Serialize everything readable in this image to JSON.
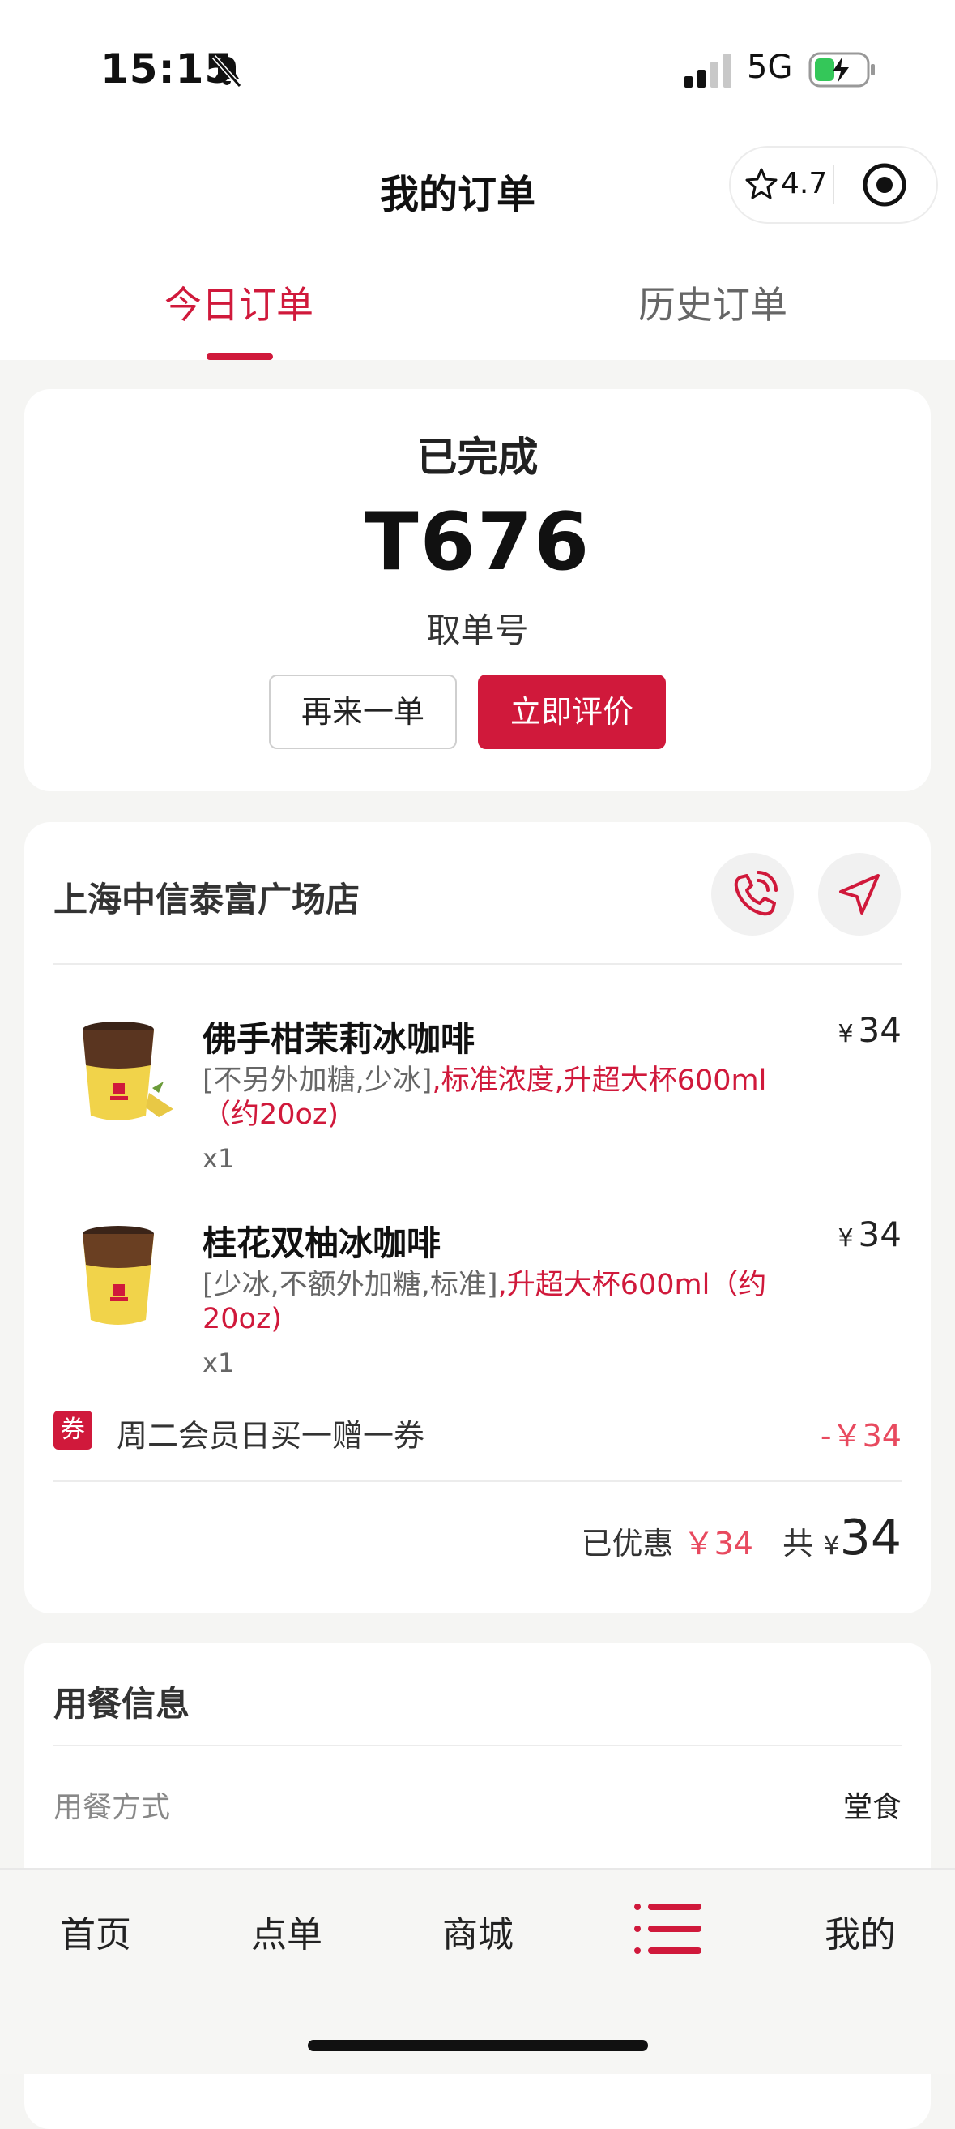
{
  "status_bar": {
    "time": "15:15",
    "network": "5G"
  },
  "header": {
    "title": "我的订单",
    "rating": "4.7"
  },
  "tabs": [
    {
      "label": "今日订单",
      "active": true
    },
    {
      "label": "历史订单",
      "active": false
    }
  ],
  "order_status": {
    "status": "已完成",
    "pickup_number": "T676",
    "pickup_label": "取单号",
    "reorder_label": "再来一单",
    "rate_label": "立即评价"
  },
  "store": {
    "name": "上海中信泰富广场店"
  },
  "items": [
    {
      "name": "佛手柑茉莉冰咖啡",
      "currency": "¥",
      "price": "34",
      "options_plain": "[不另外加糖,少冰]",
      "options_highlight": ",标准浓度,升超大杯600ml（约20oz)",
      "qty": "x1"
    },
    {
      "name": "桂花双柚冰咖啡",
      "currency": "¥",
      "price": "34",
      "options_plain": "[少冰,不额外加糖,标准]",
      "options_highlight": ",升超大杯600ml（约20oz)",
      "qty": "x1"
    }
  ],
  "coupon": {
    "tag": "券",
    "name": "周二会员日买一赠一券",
    "amount": "-￥34"
  },
  "totals": {
    "discount_label": "已优惠",
    "discount_amount": "￥34",
    "total_label": "共",
    "currency": "¥",
    "total_amount": "34"
  },
  "dining": {
    "title": "用餐信息",
    "method_label": "用餐方式",
    "method_value": "堂食"
  },
  "bottom_nav": [
    "首页",
    "点单",
    "商城",
    "我的"
  ],
  "colors": {
    "accent": "#d0193b",
    "discount": "#e84a5f"
  }
}
